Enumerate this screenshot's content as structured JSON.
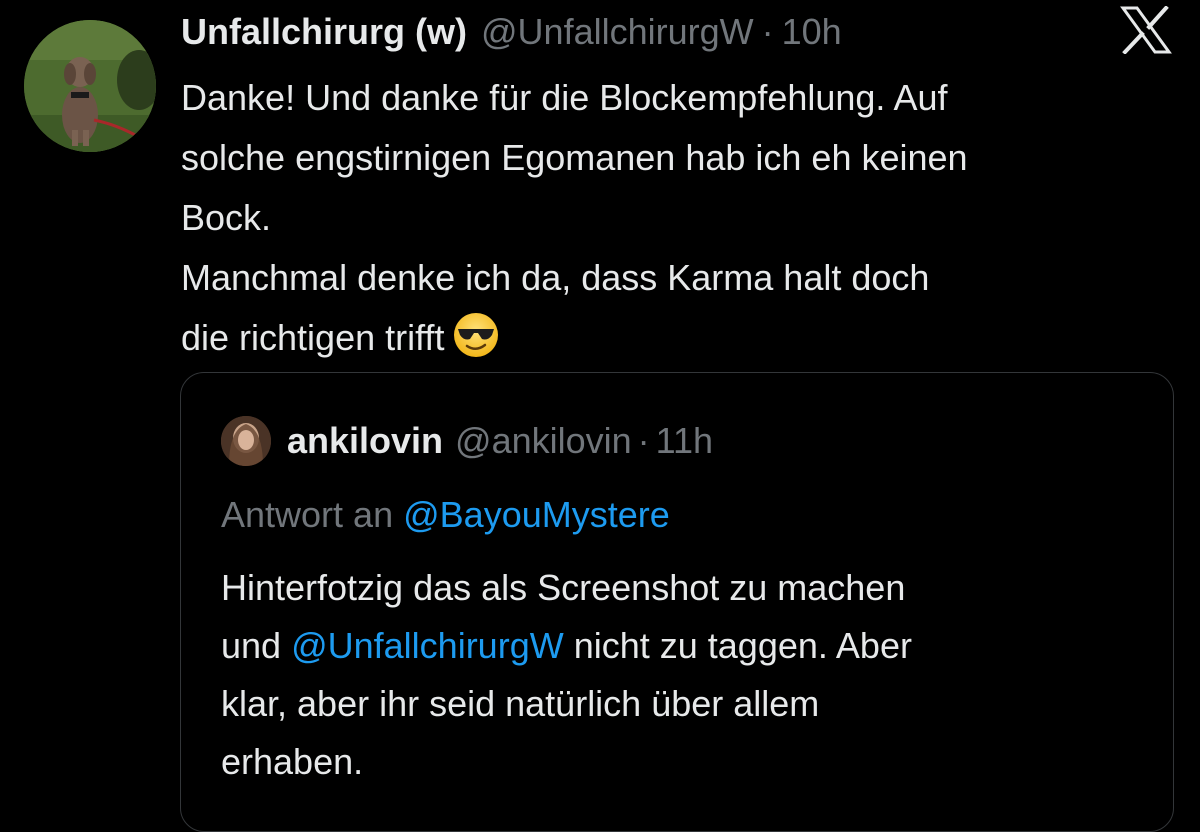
{
  "tweet": {
    "author_name": "Unfallchirurg (w)",
    "handle": "@UnfallchirurgW",
    "separator": "·",
    "time": "10h",
    "lines": [
      "Danke! Und danke für die Blockempfehlung. Auf",
      "solche engstirnigen Egomanen hab ich eh keinen",
      "Bock.",
      "Manchmal denke ich da, dass Karma halt doch",
      "die richtigen trifft"
    ],
    "emoji": "smiling-face-with-sunglasses",
    "avatar_icon": "dog-avatar"
  },
  "app": {
    "logo_icon": "x-logo-icon"
  },
  "quote": {
    "author_name": "ankilovin",
    "handle": "@ankilovin",
    "separator": "·",
    "time": "11h",
    "reply_prefix": "Antwort an",
    "reply_mention": "@BayouMystere",
    "line1": "Hinterfotzig das als Screenshot zu machen",
    "line2_prefix": "und",
    "line2_mention": "@UnfallchirurgW",
    "line2_suffix": "nicht zu taggen. Aber",
    "line3": "klar, aber ihr seid natürlich über allem",
    "line4": "erhaben."
  },
  "colors": {
    "background": "#000000",
    "text": "#e7e9ea",
    "muted": "#71767b",
    "link": "#1d9bf0",
    "border": "#333639"
  }
}
